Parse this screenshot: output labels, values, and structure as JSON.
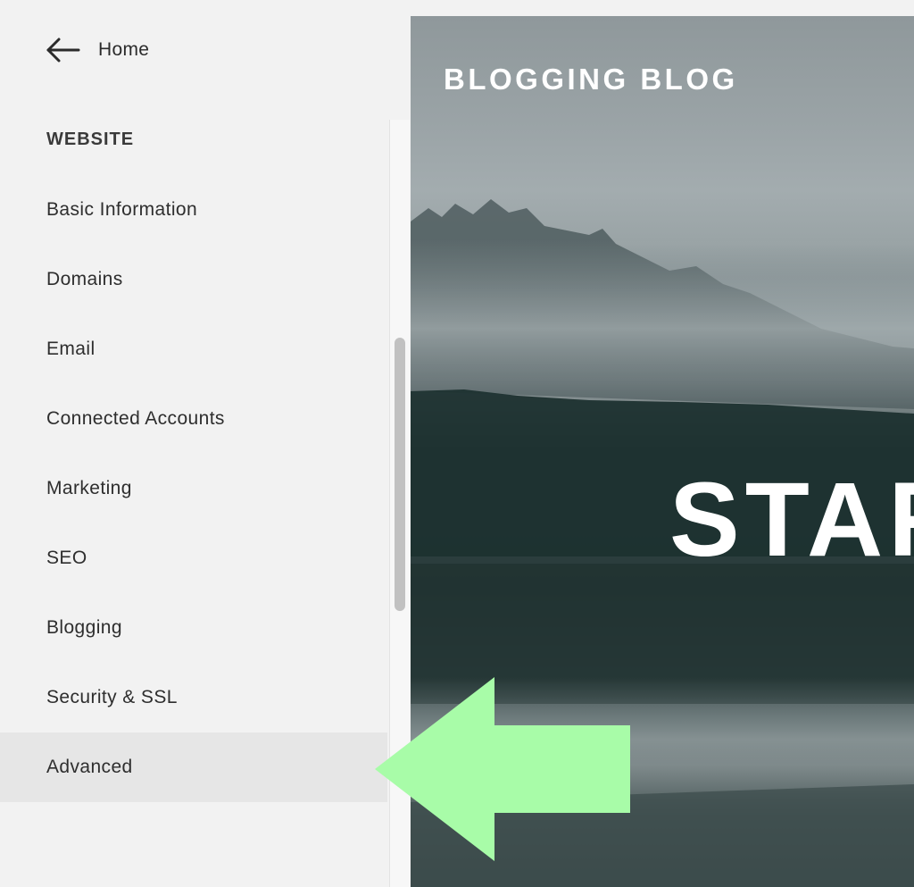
{
  "nav": {
    "back_label": "Home",
    "back_icon": "arrow-left-icon"
  },
  "sidebar": {
    "section_heading": "WEBSITE",
    "items": [
      {
        "label": "Basic Information",
        "active": false
      },
      {
        "label": "Domains",
        "active": false
      },
      {
        "label": "Email",
        "active": false
      },
      {
        "label": "Connected Accounts",
        "active": false
      },
      {
        "label": "Marketing",
        "active": false
      },
      {
        "label": "SEO",
        "active": false
      },
      {
        "label": "Blogging",
        "active": false
      },
      {
        "label": "Security & SSL",
        "active": false
      },
      {
        "label": "Advanced",
        "active": true
      }
    ]
  },
  "preview": {
    "site_title": "BLOGGING BLOG",
    "hero_text": "STAR"
  },
  "annotation": {
    "icon": "pointer-arrow-icon",
    "color": "#a8fca8"
  },
  "colors": {
    "sidebar_bg": "#f2f2f2",
    "active_item_bg": "#e6e6e6",
    "text": "#2e2e2e"
  }
}
